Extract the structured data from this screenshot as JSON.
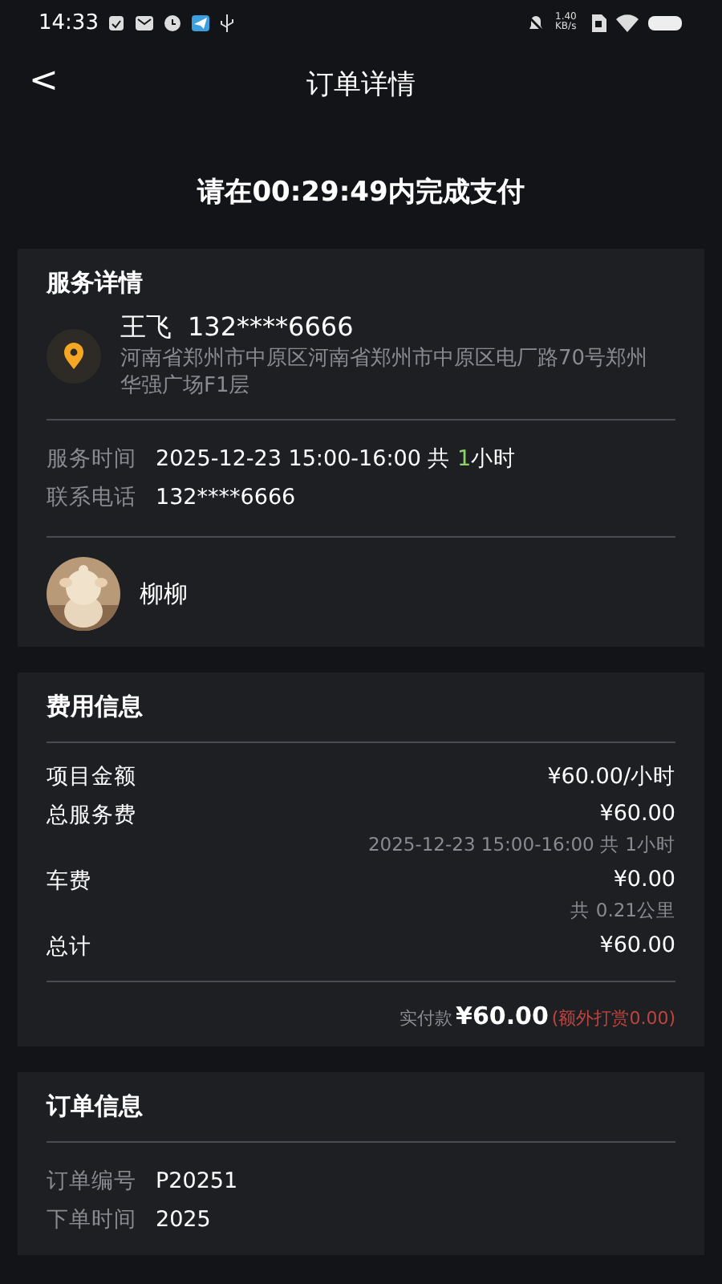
{
  "status_bar": {
    "time": "14:33",
    "network_speed": "1.40 KB/s"
  },
  "nav": {
    "back": "<",
    "title": "订单详情"
  },
  "countdown": "请在00:29:49内完成支付",
  "service": {
    "title": "服务详情",
    "contact_name": "王飞",
    "contact_phone": "132****6666",
    "address": "河南省郑州市中原区河南省郑州市中原区电厂路70号郑州华强广场F1层",
    "time_label": "服务时间",
    "time_value": {
      "prefix": "2025-12-23 15:00-16:00 共 ",
      "hours": "1",
      "suffix": "小时"
    },
    "phone_label": "联系电话",
    "phone_value": "132****6666",
    "provider": {
      "name": "柳柳"
    }
  },
  "fees": {
    "title": "费用信息",
    "rows": [
      {
        "label": "项目金额",
        "value": "¥60.00/小时"
      },
      {
        "label": "总服务费",
        "value": "¥60.00",
        "note": "2025-12-23 15:00-16:00 共 1小时"
      },
      {
        "label": "车费",
        "value": "¥0.00",
        "note": "共 0.21公里"
      },
      {
        "label": "总计",
        "value": "¥60.00"
      }
    ],
    "paid_label": "实付款",
    "paid_amount": "¥60.00",
    "tip": "(额外打赏0.00)"
  },
  "order": {
    "title": "订单信息",
    "rows": [
      {
        "label": "订单编号",
        "value": "P20251"
      },
      {
        "label": "下单时间",
        "value": "2025"
      }
    ]
  }
}
